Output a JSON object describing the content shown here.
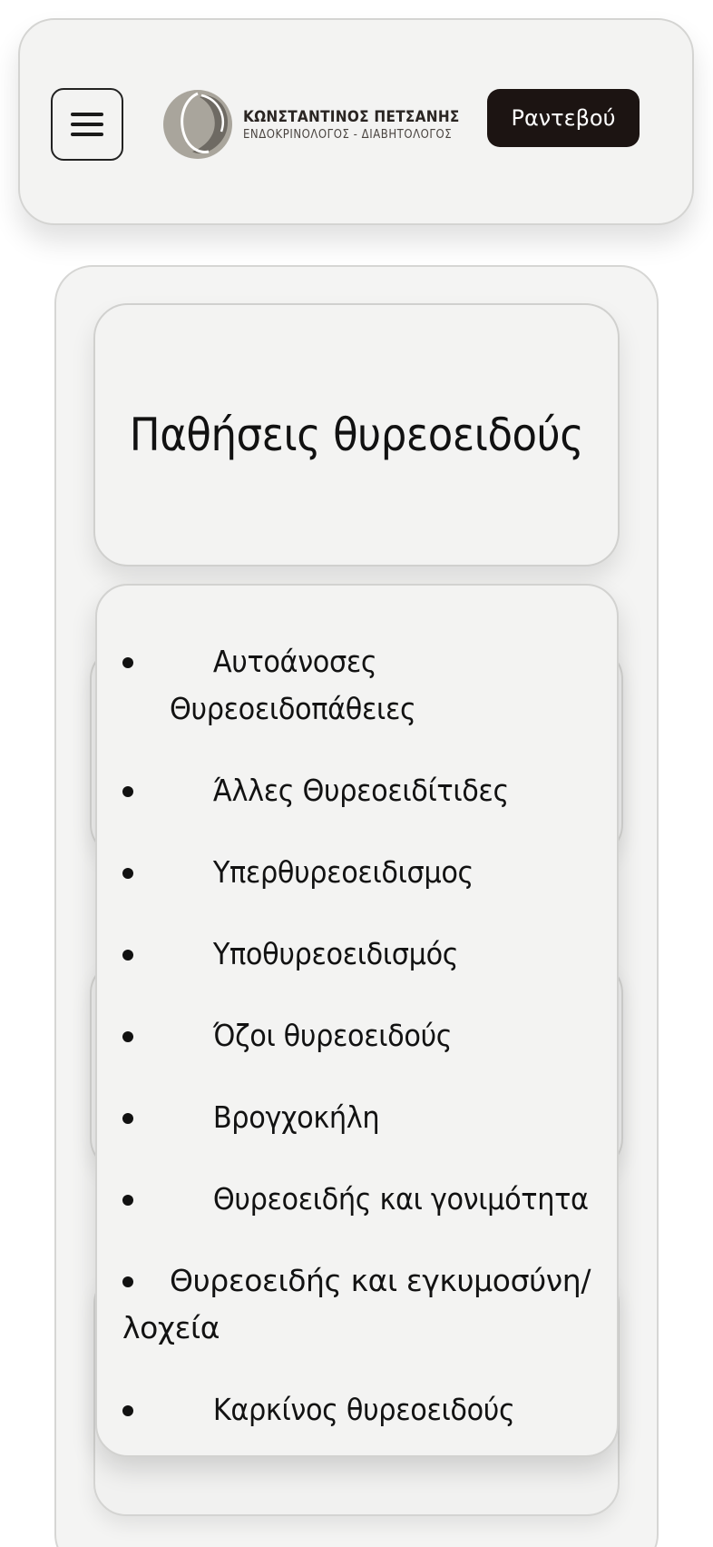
{
  "header": {
    "logo_name": "ΚΩΝΣΤΑΝΤΙΝΟΣ ΠΕΤΣΑΝΗΣ",
    "logo_subtitle": "ΕΝΔΟΚΡΙΝΟΛΟΓΟΣ - ΔΙΑΒΗΤΟΛΟΓΟΣ",
    "menu_icon": "hamburger-menu-icon",
    "appointment_label": "Ραντεβού",
    "colors": {
      "button_bg": "#1c1412",
      "card_bg": "#f3f3f2"
    }
  },
  "main": {
    "title": "Παθήσεις θυρεοειδούς",
    "items": [
      "Αυτοάνοσες Θυρεοειδοπάθειες",
      "Άλλες Θυρεοειδίτιδες",
      "Υπερθυρεοειδισμος",
      "Υποθυρεοειδισμός",
      "Όζοι θυρεοειδούς",
      "Βρογχοκήλη",
      "Θυρεοειδής και γονιμότητα",
      "Θυρεοειδής και εγκυμοσύνη/λοχεία",
      "Καρκίνος θυρεοειδούς"
    ]
  }
}
